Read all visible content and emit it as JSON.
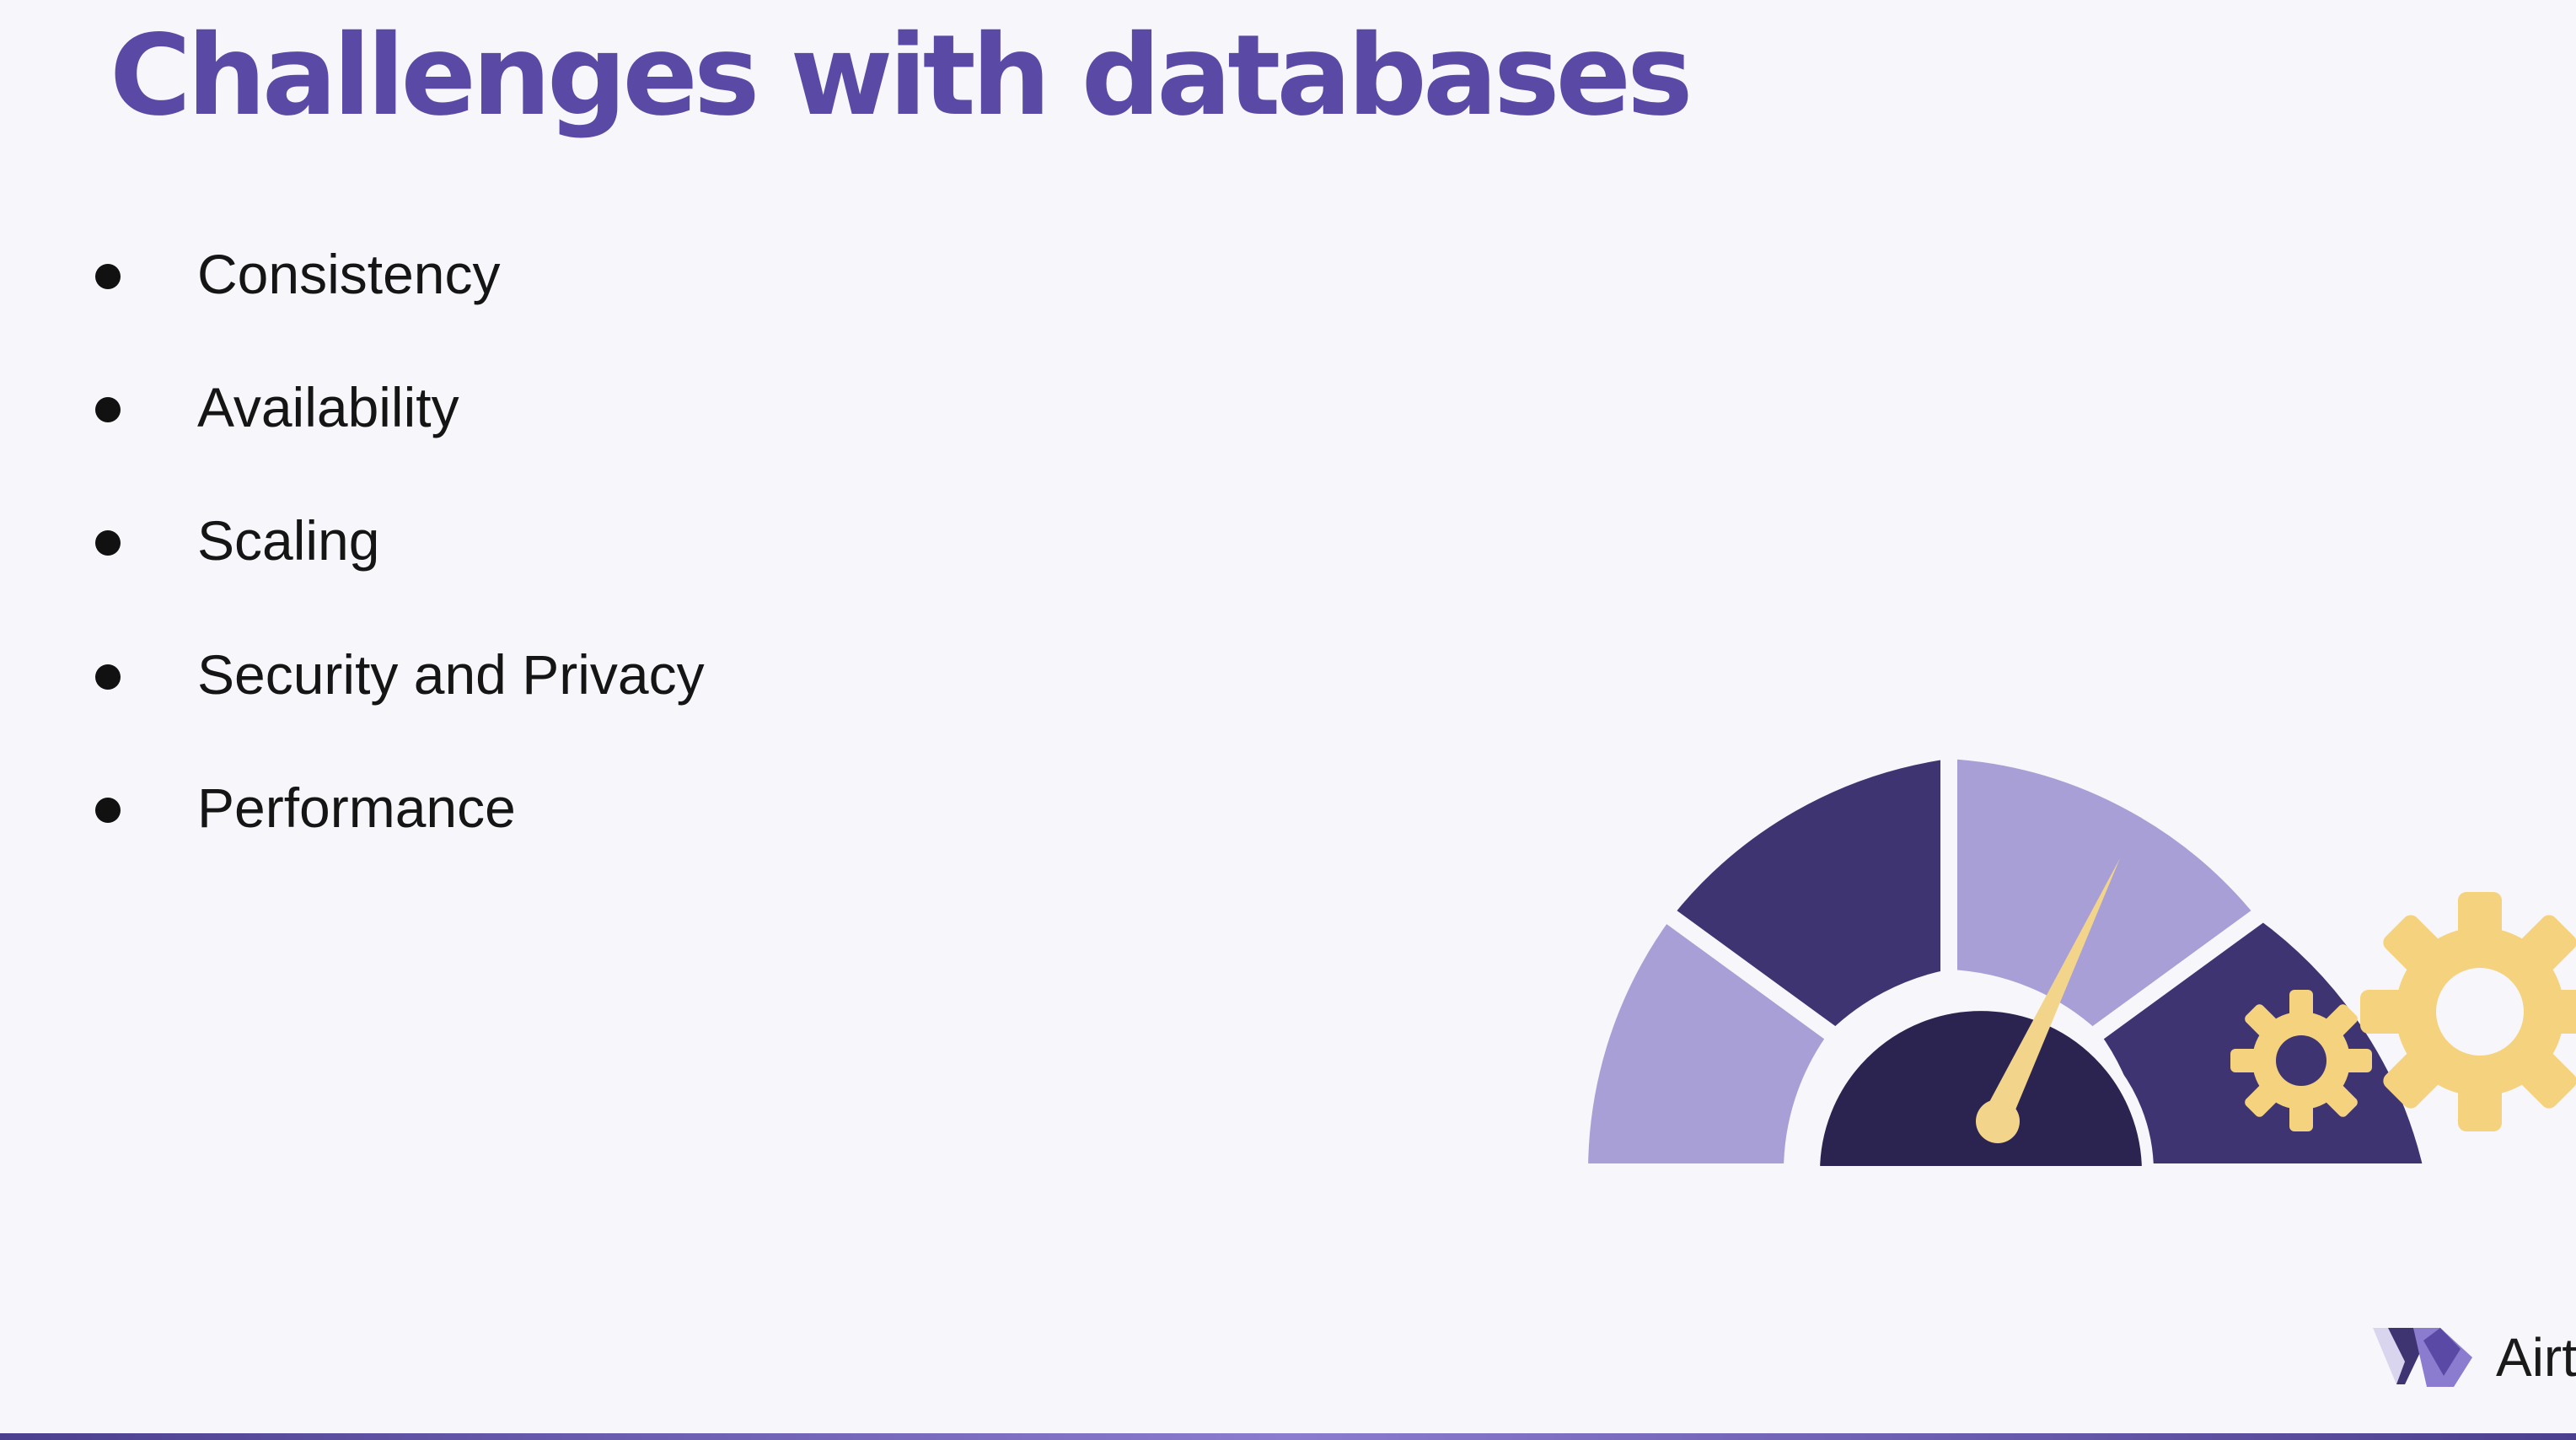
{
  "slide": {
    "title": "Challenges with databases",
    "bullets": [
      "Consistency",
      "Availability",
      "Scaling",
      "Security and Privacy",
      "Performance"
    ]
  },
  "illustration": {
    "icons": [
      "speedometer-icon",
      "gear-icon"
    ],
    "colors": {
      "light_purple": "#a89fd7",
      "dark_purple": "#3f3472",
      "hub": "#2c2450",
      "needle": "#f2d58a",
      "gear": "#f5d27e"
    }
  },
  "brand": {
    "name": "Airt"
  },
  "theme": {
    "title_color": "#5a4aa6",
    "background": "#f7f6fb",
    "text_color": "#151515"
  }
}
